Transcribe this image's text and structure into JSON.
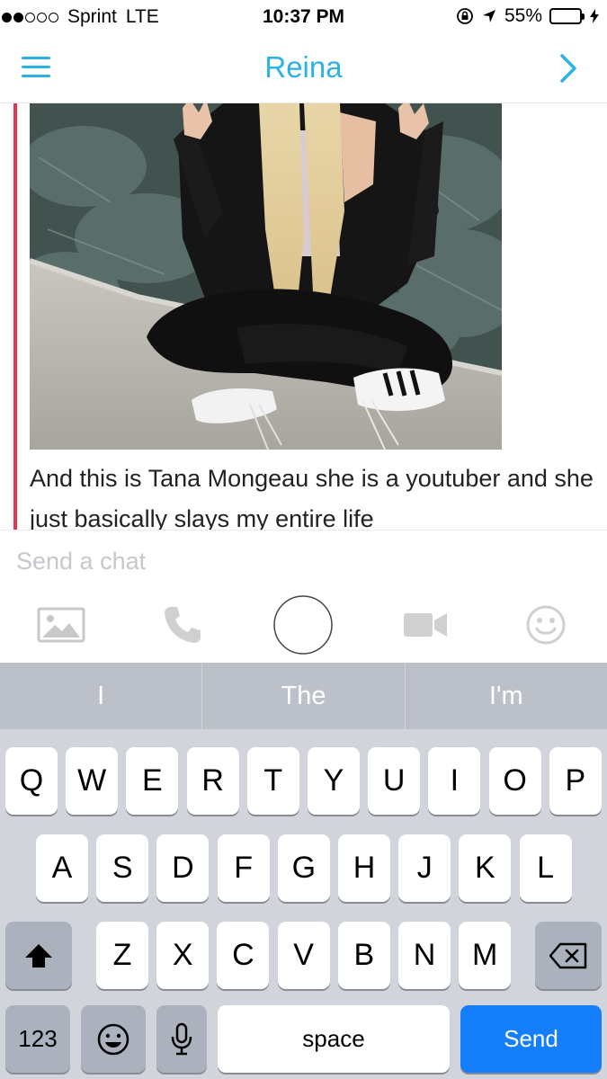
{
  "status": {
    "carrier": "Sprint",
    "network": "LTE",
    "time": "10:37 PM",
    "battery": "55%",
    "battery_level": 0.55,
    "signal_bars_filled": 2,
    "signal_bars_total": 5
  },
  "nav": {
    "title": "Reina",
    "menu_icon": "hamburger-menu-icon",
    "next_icon": "chevron-right-icon"
  },
  "chat": {
    "message_text": "And this is Tana Mongeau she is a youtuber and she just basically slays my entire life",
    "accent_color": "#e8334f"
  },
  "input": {
    "placeholder": "Send a chat",
    "value": ""
  },
  "tools": [
    "image-icon",
    "phone-icon",
    "capture-button",
    "video-camera-icon",
    "emoji-icon"
  ],
  "keyboard": {
    "suggestions": [
      "I",
      "The",
      "I'm"
    ],
    "row1": [
      "Q",
      "W",
      "E",
      "R",
      "T",
      "Y",
      "U",
      "I",
      "O",
      "P"
    ],
    "row2": [
      "A",
      "S",
      "D",
      "F",
      "G",
      "H",
      "J",
      "K",
      "L"
    ],
    "row3": [
      "Z",
      "X",
      "C",
      "V",
      "B",
      "N",
      "M"
    ],
    "numbers_label": "123",
    "space_label": "space",
    "send_label": "Send"
  },
  "colors": {
    "brand": "#2bb2e6",
    "send": "#147efb",
    "keyboard_bg": "#d1d5db"
  }
}
